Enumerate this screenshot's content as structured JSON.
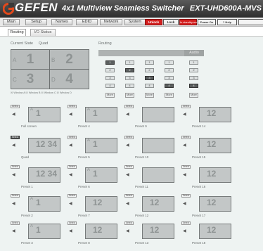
{
  "header": {
    "logo_icon": "gefen-logo-icon",
    "brand": "GEFEN",
    "title": "4x1 Multiview Seamless Switcher",
    "model": "EXT-UHD600A-MVS"
  },
  "nav": {
    "tabs": [
      "Main",
      "Setup",
      "Names",
      "EDID",
      "Network",
      "System"
    ],
    "unlock": "Unlock",
    "lock": "Lock",
    "standby": "In standby mode",
    "power": "Power On",
    "help": "? Help"
  },
  "subtabs": [
    "Routing",
    "I/O Status"
  ],
  "current_state": {
    "label": "Current State",
    "mode": "Quad",
    "windows": [
      {
        "letter": "A",
        "source": "1"
      },
      {
        "letter": "B",
        "source": "2"
      },
      {
        "letter": "C",
        "source": "3"
      },
      {
        "letter": "D",
        "source": "4"
      }
    ],
    "legend": "☒ Window A  ☒ Window B  ☒ Window C  ☒ Window D"
  },
  "routing": {
    "label": "Routing",
    "audio_label": "Audio",
    "rows": [
      [
        "1",
        "1",
        "1",
        "1",
        "1"
      ],
      [
        "2",
        "2",
        "2",
        "2",
        "2"
      ],
      [
        "3",
        "3",
        "3",
        "3",
        "3"
      ],
      [
        "4",
        "4",
        "4",
        "4",
        "4"
      ]
    ],
    "selected": [
      [
        0,
        0
      ],
      [
        1,
        1
      ],
      [
        2,
        2
      ],
      [
        3,
        3
      ],
      [
        3,
        4
      ]
    ],
    "more": "More"
  },
  "presets": {
    "select_label": "Select",
    "speaker_icon": "speaker-icon",
    "items": [
      {
        "name": "Full screen",
        "thumb": "1",
        "letter": "A",
        "active": false
      },
      {
        "name": "Preset 4",
        "thumb": "1",
        "letter": "A",
        "active": false
      },
      {
        "name": "Preset 9",
        "thumb": "",
        "letter": "",
        "active": false
      },
      {
        "name": "Preset 14",
        "thumb": "12",
        "letter": "",
        "active": false
      },
      {
        "name": "Quad",
        "thumb": "12 34",
        "letter": "",
        "active": true
      },
      {
        "name": "Preset 5",
        "thumb": "1",
        "letter": "A",
        "active": false
      },
      {
        "name": "Preset 10",
        "thumb": "",
        "letter": "",
        "active": false
      },
      {
        "name": "Preset 15",
        "thumb": "12",
        "letter": "",
        "active": false
      },
      {
        "name": "Preset 1",
        "thumb": "12 34",
        "letter": "",
        "active": false
      },
      {
        "name": "Preset 6",
        "thumb": "1",
        "letter": "A",
        "active": false
      },
      {
        "name": "Preset 11",
        "thumb": "",
        "letter": "",
        "active": false
      },
      {
        "name": "Preset 16",
        "thumb": "12",
        "letter": "",
        "active": false
      },
      {
        "name": "Preset 2",
        "thumb": "1",
        "letter": "A",
        "active": false
      },
      {
        "name": "Preset 7",
        "thumb": "12",
        "letter": "",
        "active": false
      },
      {
        "name": "Preset 12",
        "thumb": "12",
        "letter": "",
        "active": false
      },
      {
        "name": "Preset 17",
        "thumb": "12",
        "letter": "",
        "active": false
      },
      {
        "name": "Preset 3",
        "thumb": "1",
        "letter": "A",
        "active": false
      },
      {
        "name": "Preset 8",
        "thumb": "12",
        "letter": "",
        "active": false
      },
      {
        "name": "Preset 13",
        "thumb": "12",
        "letter": "",
        "active": false
      },
      {
        "name": "Preset 18",
        "thumb": "12",
        "letter": "",
        "active": false
      }
    ]
  },
  "colors": {
    "brand_orange": "#e2491b",
    "unlock_red": "#d41f1f"
  }
}
